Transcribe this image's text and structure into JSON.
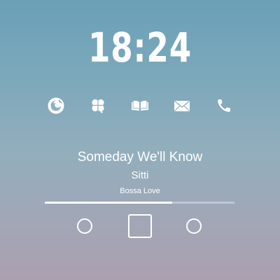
{
  "clock": {
    "time": "18:24"
  },
  "dock": {
    "apps": [
      {
        "icon": "firefox-icon"
      },
      {
        "icon": "clover-icon"
      },
      {
        "icon": "book-icon"
      },
      {
        "icon": "mail-icon"
      },
      {
        "icon": "phone-icon"
      }
    ]
  },
  "now_playing": {
    "title": "Someday We'll Know",
    "artist": "Sitti",
    "album": "Bossa Love",
    "progress": 0.67
  },
  "controls": [
    {
      "icon": "previous-circle-icon"
    },
    {
      "icon": "play-pause-square-icon"
    },
    {
      "icon": "next-circle-icon"
    }
  ]
}
